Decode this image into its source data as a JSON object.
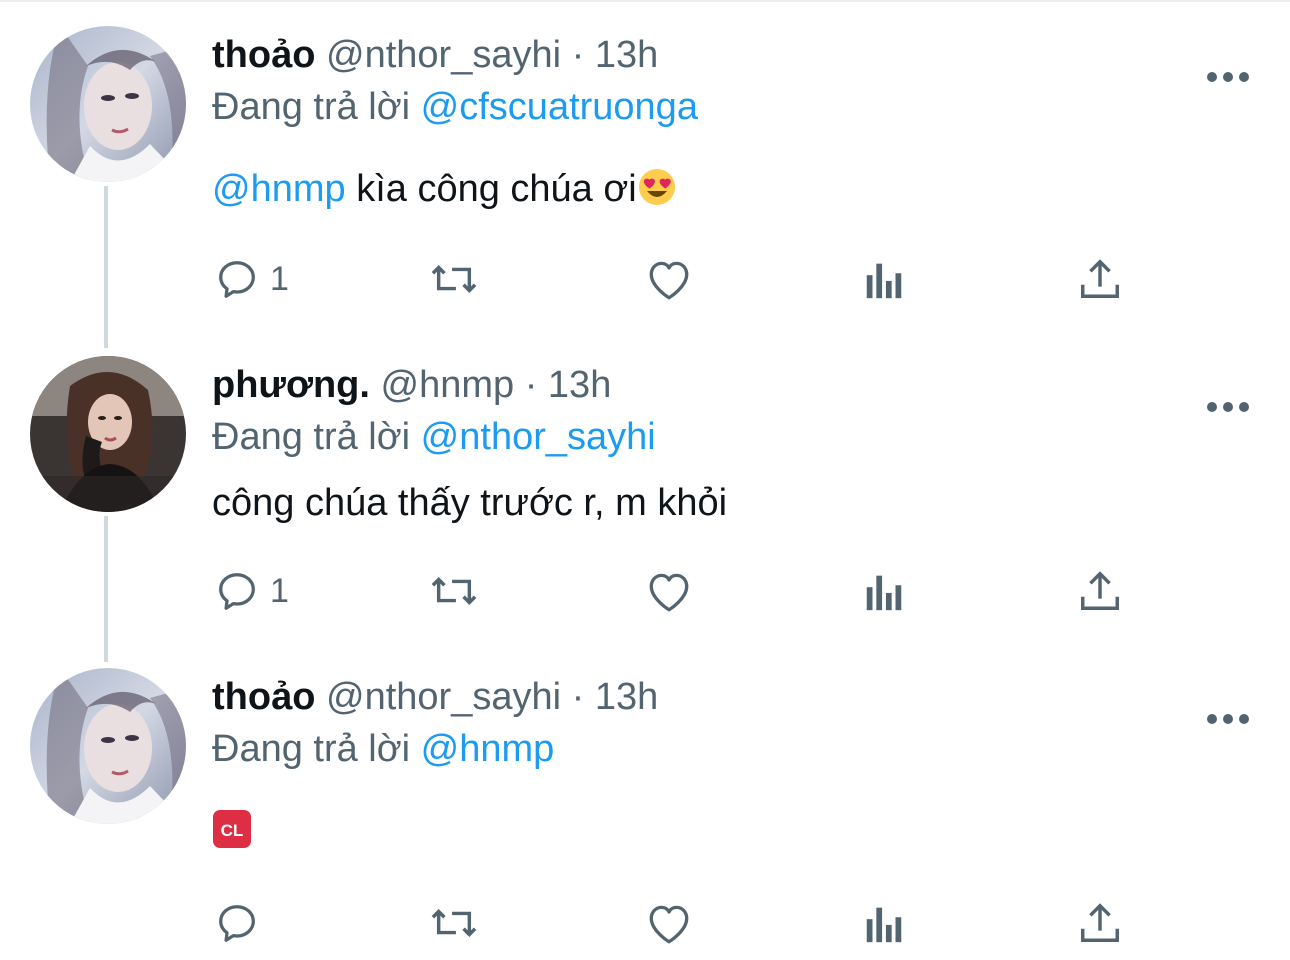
{
  "tweets": [
    {
      "name": "thoảo",
      "handle": "@nthor_sayhi",
      "time": "13h",
      "reply_prefix": "Đang trả lời",
      "reply_to": "@cfscuatruonga",
      "mention": "@hnmp",
      "text": " kìa công chúa ơi",
      "emoji": "smiling-face-with-heart-eyes",
      "reply_count": "1",
      "avatar_icon": "avatar-thoao"
    },
    {
      "name": "phương.",
      "handle": "@hnmp",
      "time": "13h",
      "reply_prefix": "Đang trả lời",
      "reply_to": "@nthor_sayhi",
      "mention": "",
      "text": "công chúa thấy trước r, m khỏi",
      "emoji": "",
      "reply_count": "1",
      "avatar_icon": "avatar-phuong"
    },
    {
      "name": "thoảo",
      "handle": "@nthor_sayhi",
      "time": "13h",
      "reply_prefix": "Đang trả lời",
      "reply_to": "@hnmp",
      "mention": "",
      "text": "",
      "emoji": "cl-button",
      "emoji_text": "CL",
      "reply_count": "",
      "avatar_icon": "avatar-thoao"
    }
  ],
  "separator": "·",
  "colors": {
    "link": "#1d9bf0",
    "secondary": "#536471",
    "primary": "#0f1419",
    "thread_line": "#cfd9de"
  }
}
